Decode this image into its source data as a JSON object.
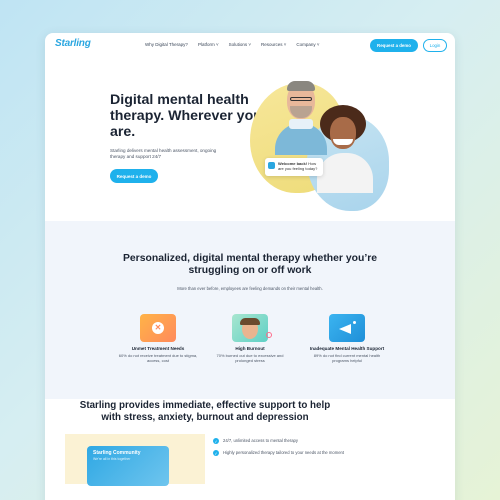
{
  "nav": {
    "logo": "Starling",
    "links": [
      "Why Digital Therapy?",
      "Platform ˅",
      "Solutions ˅",
      "Resources ˅",
      "Company ˅"
    ],
    "request_demo": "Request a demo",
    "login": "Login"
  },
  "hero": {
    "title": "Digital mental health therapy. Wherever you are.",
    "subtitle": "Starling delivers mental health assessment, ongoing therapy and support 24/7",
    "button": "Request a demo",
    "welcome_bold": "Welcome back!",
    "welcome_text": " How are you feeling today?"
  },
  "section2": {
    "title": "Personalized, digital mental therapy whether you’re struggling on or off work",
    "subtitle": "More than ever before, employees are feeling demands on their mental health.",
    "features": [
      {
        "icon": "x-icon",
        "title": "Unmet Treatment Needs",
        "desc": "60% do not receive treatment due to stigma, access, cost"
      },
      {
        "icon": "stressed-person-icon",
        "title": "High Burnout",
        "desc": "70% burned out due to excessive and prolonged stress"
      },
      {
        "icon": "megaphone-icon",
        "title": "Inadequate Mental Health Support",
        "desc": "89% do not find current mental health programs helpful"
      }
    ]
  },
  "section3": {
    "title": "Starling provides immediate, effective support to help with stress, anxiety, burnout and depression",
    "card_title": "Starling Community",
    "card_sub": "We're all in this together",
    "bullets": [
      "24/7, unlimited access to mental therapy",
      "Highly personalized therapy tailored to your needs at the moment"
    ]
  },
  "colors": {
    "accent": "#1fb1ec",
    "heading": "#1b2433",
    "section_bg": "#f1f5fb"
  }
}
